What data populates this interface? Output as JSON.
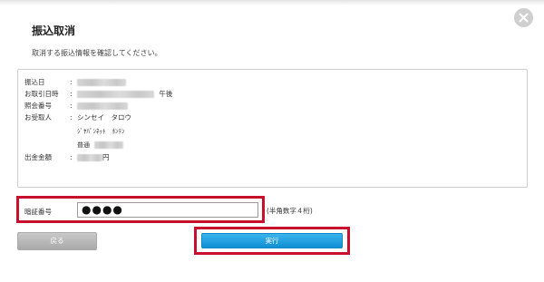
{
  "dialog": {
    "title": "振込取消",
    "instruction": "取消する振込情報を確認してください。",
    "close_icon": "close-icon"
  },
  "info": {
    "rows": [
      {
        "label": "振込日",
        "colon": ":"
      },
      {
        "label": "お取引日時",
        "colon": ":",
        "suffix": "午後"
      },
      {
        "label": "照会番号",
        "colon": ":"
      },
      {
        "label": "お受取人",
        "colon": ":",
        "value": "シンセイ　タロウ"
      },
      {
        "label": "出金金額",
        "colon": ":",
        "suffix": "円"
      }
    ],
    "bank_branch": "ｼﾞﾔﾊﾟﾝﾈｯﾄ　ﾎﾝﾃﾝ",
    "account_type": "普通"
  },
  "pin": {
    "label": "暗証番号",
    "value": "●●●●",
    "hint": "(半角数字４桁)"
  },
  "buttons": {
    "back_label": "戻る",
    "execute_label": "実行"
  },
  "colors": {
    "highlight": "#c8102e",
    "execute": "#1a9ee0",
    "back": "#b8b8b8"
  }
}
